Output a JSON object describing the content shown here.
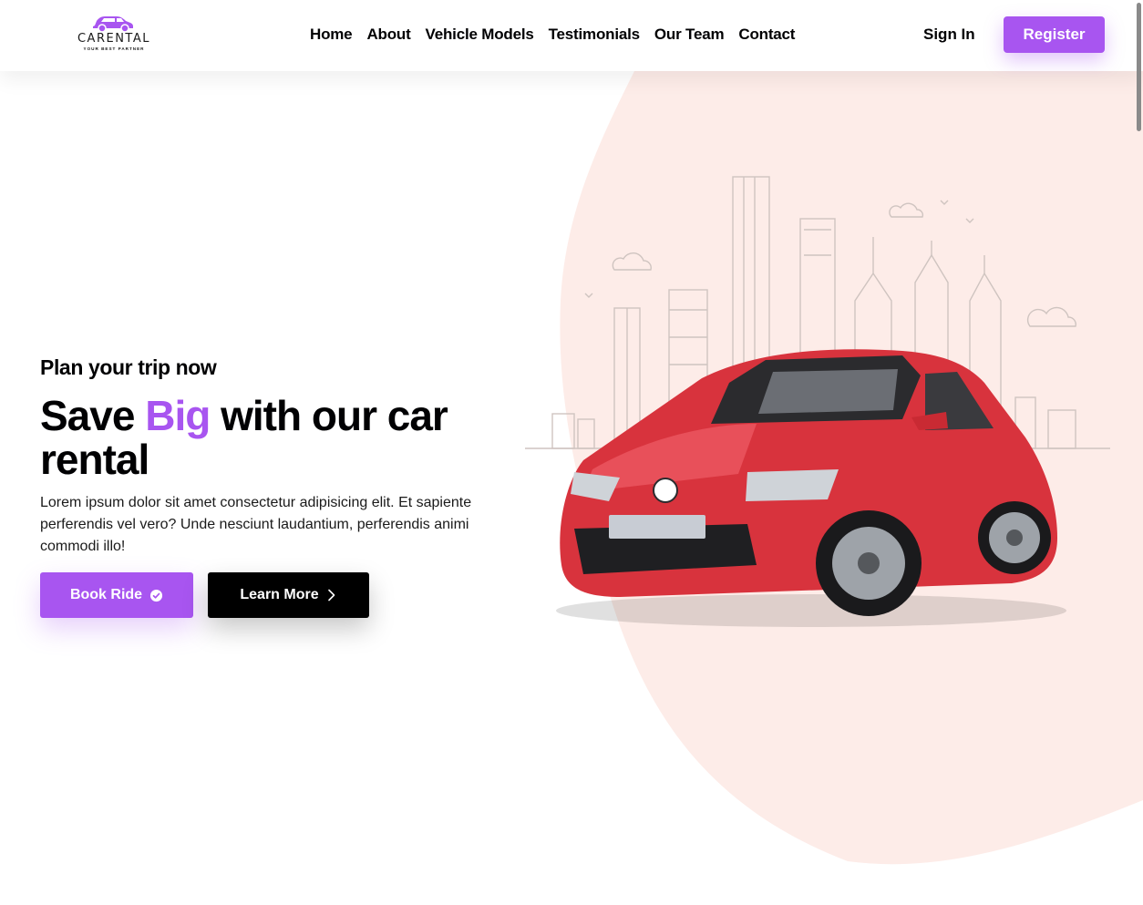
{
  "nav": {
    "logo": {
      "word": "CARENTAL",
      "tagline": "YOUR BEST PARTNER",
      "icon": "car-icon"
    },
    "links": [
      "Home",
      "About",
      "Vehicle Models",
      "Testimonials",
      "Our Team",
      "Contact"
    ],
    "sign_in": "Sign In",
    "register": "Register"
  },
  "hero": {
    "subtitle": "Plan your trip now",
    "title_before": "Save ",
    "title_accent": "Big",
    "title_after": " with our car rental",
    "description": "Lorem ipsum dolor sit amet consectetur adipisicing elit. Et sapiente perferendis vel vero? Unde nesciunt laudantium, perferendis animi commodi illo!",
    "book_button": "Book Ride",
    "book_icon": "check-circle-icon",
    "learn_button": "Learn More",
    "learn_icon": "chevron-right-icon",
    "image": "red-hatchback-car-with-city-skyline"
  },
  "colors": {
    "accent": "#a855f0",
    "blob": "#fdece8",
    "text": "#010103",
    "dark_button": "#000000"
  }
}
